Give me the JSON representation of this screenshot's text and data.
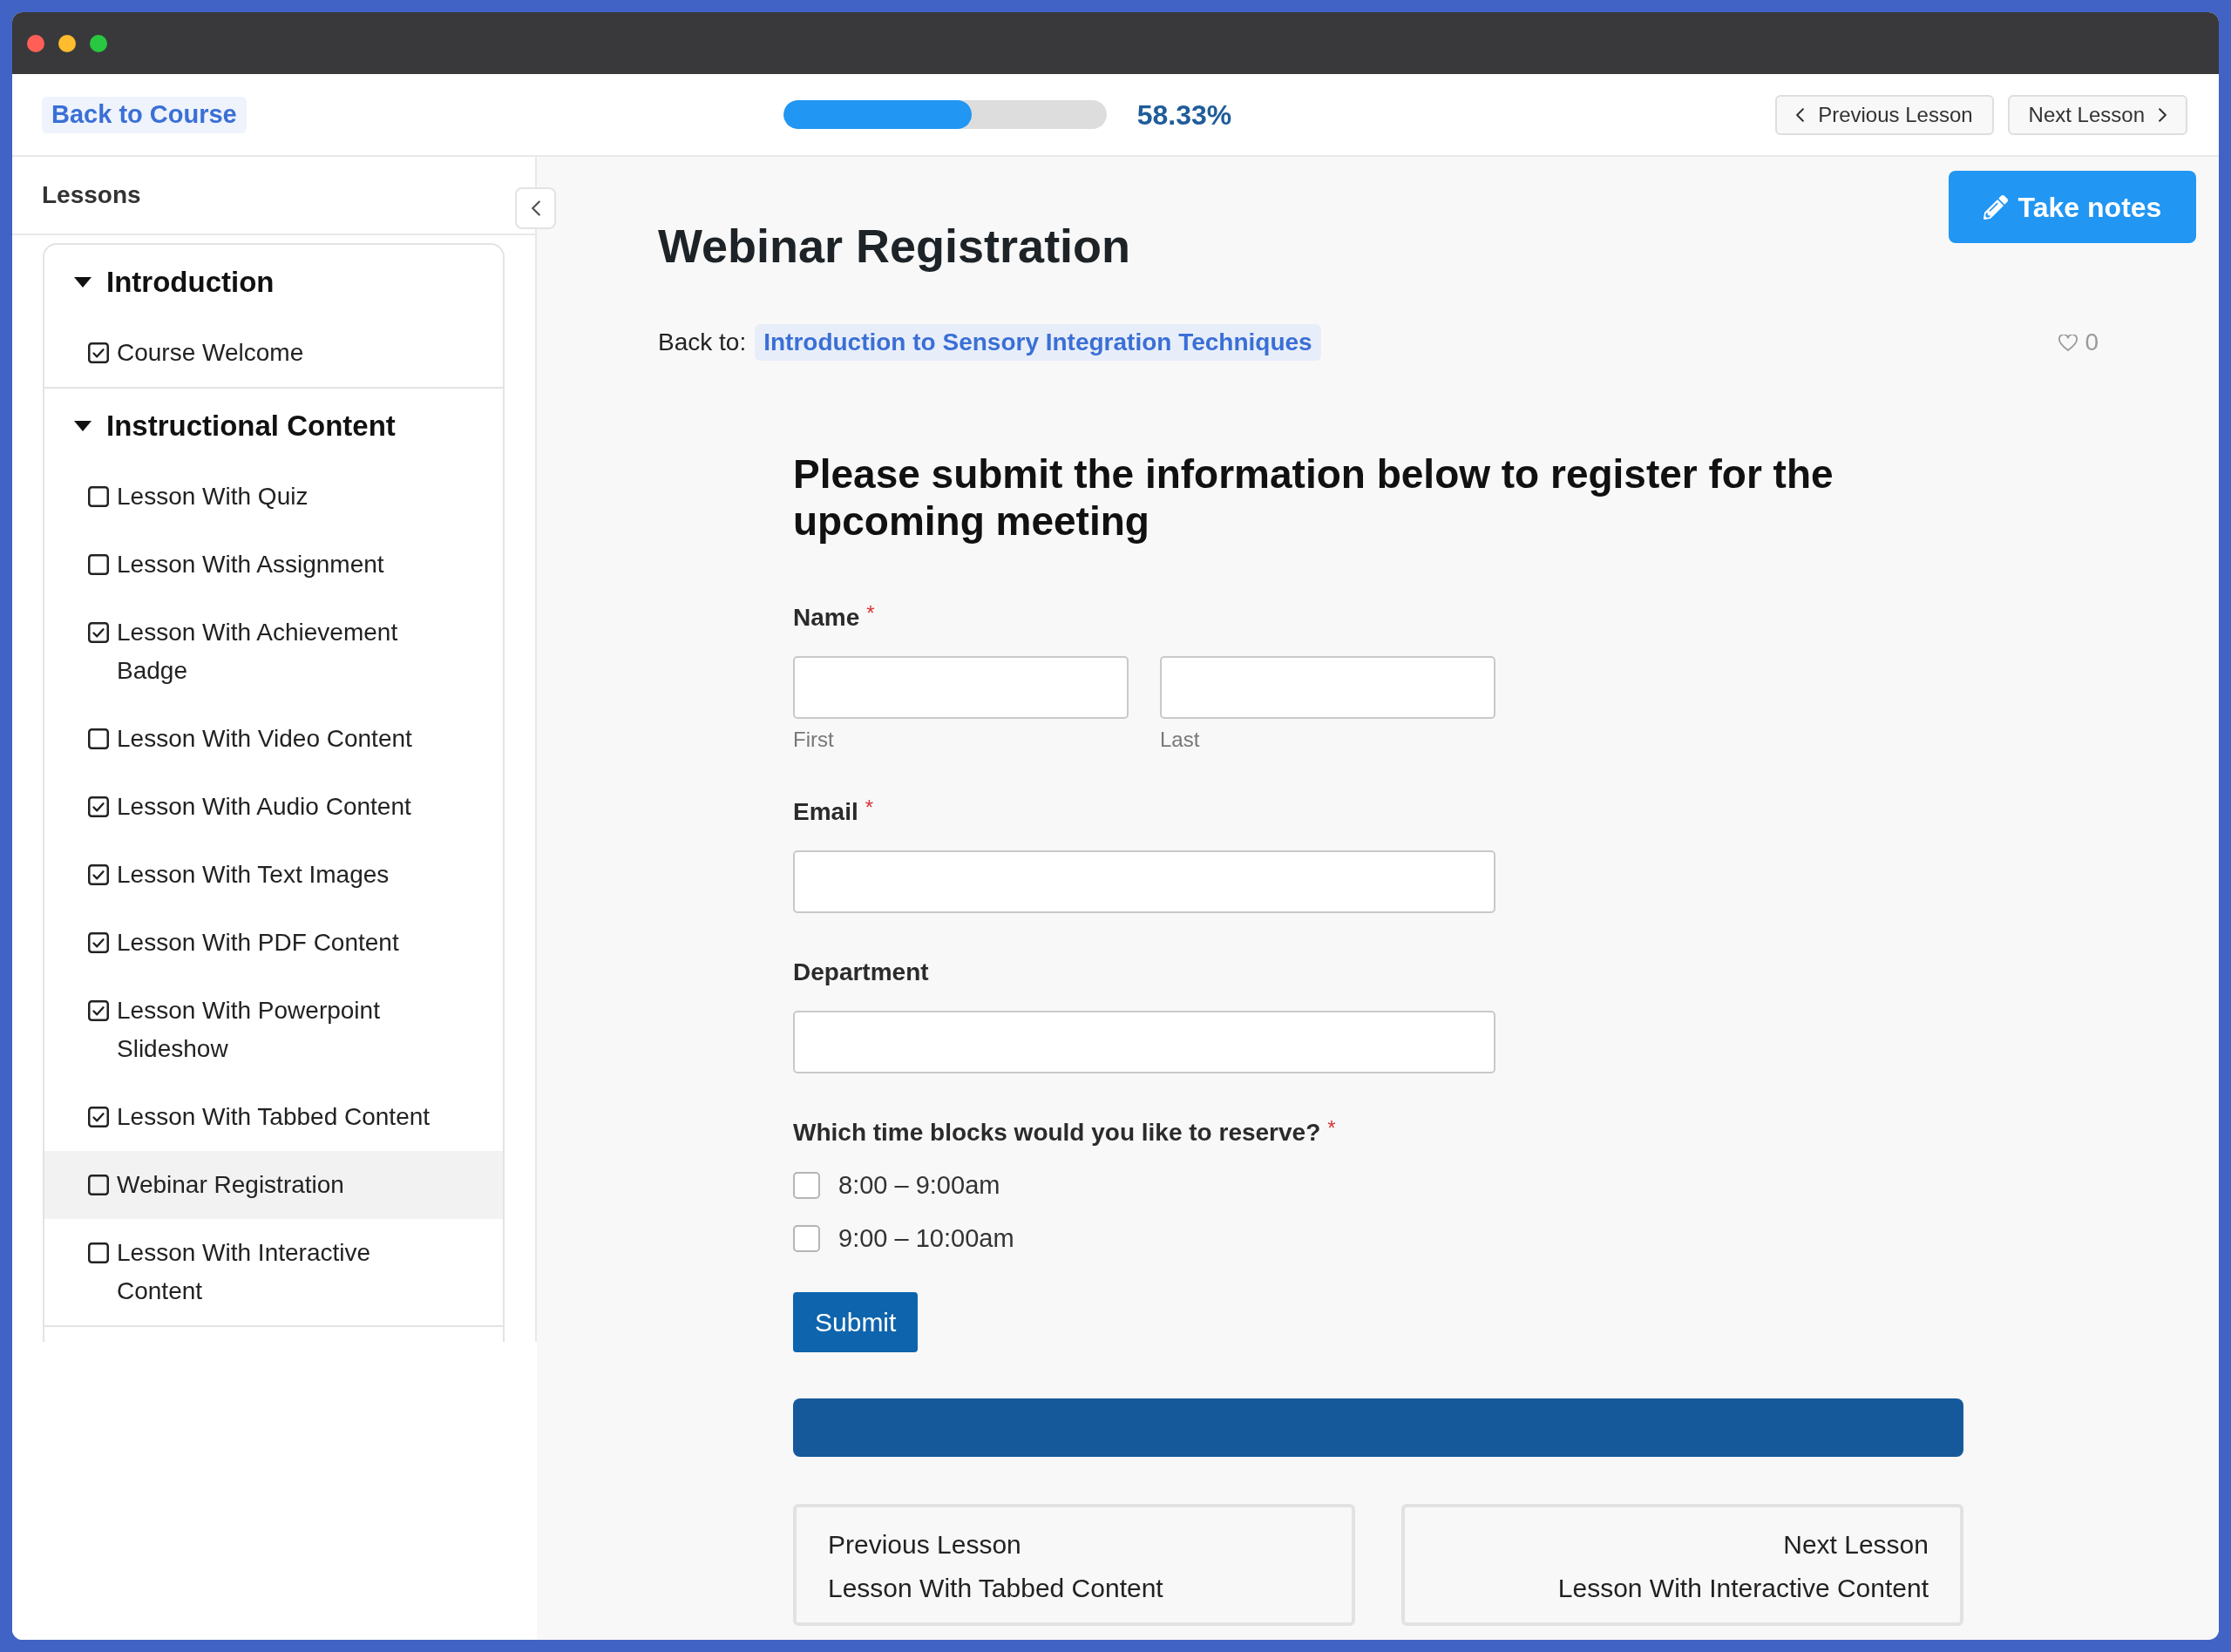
{
  "top_bar": {
    "back_link": "Back to Course",
    "progress": {
      "level": 0.5833,
      "reading": "58.33%"
    },
    "nav_buttons": [
      {
        "kind": "previous",
        "label": "Previous Lesson"
      },
      {
        "kind": "next",
        "label": "Next Lesson"
      }
    ]
  },
  "sidebar": {
    "title": "Lessons",
    "sections": [
      {
        "title": "Introduction",
        "expanded": true,
        "lessons": [
          {
            "label": "Course Welcome",
            "completed": true,
            "selected": false
          }
        ]
      },
      {
        "title": "Instructional Content",
        "expanded": true,
        "lessons": [
          {
            "label": "Lesson With Quiz",
            "completed": false,
            "selected": false
          },
          {
            "label": "Lesson With Assignment",
            "completed": false,
            "selected": false
          },
          {
            "label": "Lesson With Achievement Badge",
            "completed": true,
            "selected": false
          },
          {
            "label": "Lesson With Video Content",
            "completed": false,
            "selected": false
          },
          {
            "label": "Lesson With Audio Content",
            "completed": true,
            "selected": false
          },
          {
            "label": "Lesson With Text Images",
            "completed": true,
            "selected": false
          },
          {
            "label": "Lesson With PDF Content",
            "completed": true,
            "selected": false
          },
          {
            "label": "Lesson With Powerpoint Slideshow",
            "completed": true,
            "selected": false
          },
          {
            "label": "Lesson With Tabbed Content",
            "completed": true,
            "selected": false
          },
          {
            "label": "Webinar Registration",
            "completed": false,
            "selected": true
          },
          {
            "label": "Lesson With Interactive Content",
            "completed": false,
            "selected": false
          }
        ]
      }
    ]
  },
  "lesson": {
    "notes_button": "Take notes",
    "title": "Webinar Registration",
    "back_to": {
      "label": "Back to:",
      "link": "Introduction to Sensory Integration Techniques"
    },
    "likes": "0"
  },
  "form": {
    "heading": "Please submit the information below to register for the upcoming meeting",
    "fields": [
      {
        "kind": "name",
        "label": "Name",
        "required_mark": "*",
        "parts": [
          {
            "sublabel": "First"
          },
          {
            "sublabel": "Last"
          }
        ]
      },
      {
        "kind": "text",
        "label": "Email",
        "required_mark": "*"
      },
      {
        "kind": "text",
        "label": "Department"
      },
      {
        "kind": "checkboxes",
        "label": "Which time blocks would you like to reserve?",
        "required_mark": "*",
        "options": [
          {
            "label": "8:00 – 9:00am",
            "checked": false
          },
          {
            "label": "9:00 – 10:00am",
            "checked": false
          }
        ]
      }
    ],
    "submit": "Submit"
  },
  "lesson_nav": [
    {
      "kind": "previous",
      "caption": "Previous Lesson",
      "title": "Lesson With Tabbed Content"
    },
    {
      "kind": "next",
      "caption": "Next Lesson",
      "title": "Lesson With Interactive Content"
    }
  ]
}
